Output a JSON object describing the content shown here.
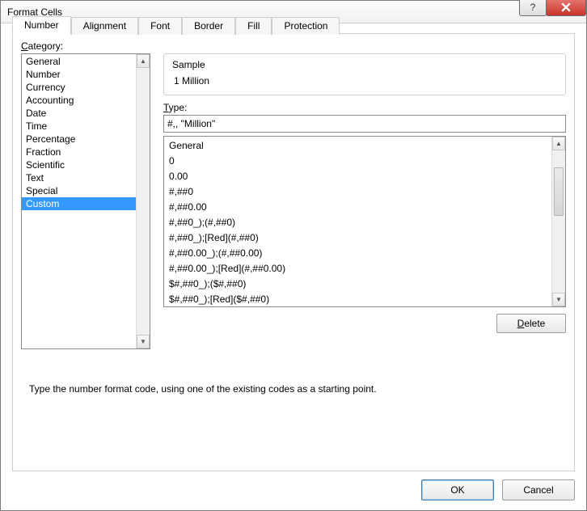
{
  "window": {
    "title": "Format Cells"
  },
  "tabs": {
    "items": [
      {
        "label": "Number"
      },
      {
        "label": "Alignment"
      },
      {
        "label": "Font"
      },
      {
        "label": "Border"
      },
      {
        "label": "Fill"
      },
      {
        "label": "Protection"
      }
    ],
    "active_index": 0
  },
  "category": {
    "label_pre": "",
    "label_ul": "C",
    "label_post": "ategory:",
    "items": [
      "General",
      "Number",
      "Currency",
      "Accounting",
      "Date",
      "Time",
      "Percentage",
      "Fraction",
      "Scientific",
      "Text",
      "Special",
      "Custom"
    ],
    "selected_index": 11
  },
  "sample": {
    "legend": "Sample",
    "value": "1 Million"
  },
  "type": {
    "label_ul": "T",
    "label_post": "ype:",
    "value": "#,, \"Million\"",
    "options": [
      "General",
      "0",
      "0.00",
      "#,##0",
      "#,##0.00",
      "#,##0_);(#,##0)",
      "#,##0_);[Red](#,##0)",
      "#,##0.00_);(#,##0.00)",
      "#,##0.00_);[Red](#,##0.00)",
      "$#,##0_);($#,##0)",
      "$#,##0_);[Red]($#,##0)"
    ]
  },
  "buttons": {
    "delete_ul": "D",
    "delete_post": "elete",
    "ok": "OK",
    "cancel": "Cancel"
  },
  "hint": "Type the number format code, using one of the existing codes as a starting point."
}
